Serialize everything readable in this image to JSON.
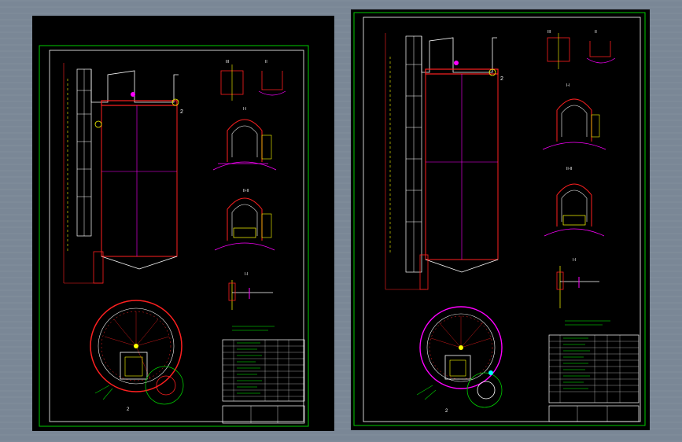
{
  "viewport": {
    "background": "#7a8796"
  },
  "colors": {
    "frame": "#00cc00",
    "outline": "#ffffff",
    "red": "#ff2020",
    "yellow": "#ffff00",
    "magenta": "#ff00ff",
    "cyan": "#00ffff",
    "table_text": "#00ff00"
  },
  "sheets": [
    {
      "id": "left",
      "section_labels": [
        "III",
        "II",
        "I-I",
        "II-II",
        "I-I"
      ],
      "callouts": [
        "2",
        "2",
        "2"
      ]
    },
    {
      "id": "right",
      "section_labels": [
        "III",
        "II",
        "I-I",
        "II-II",
        "I-I"
      ],
      "callouts": [
        "2",
        "2",
        "2"
      ]
    }
  ]
}
